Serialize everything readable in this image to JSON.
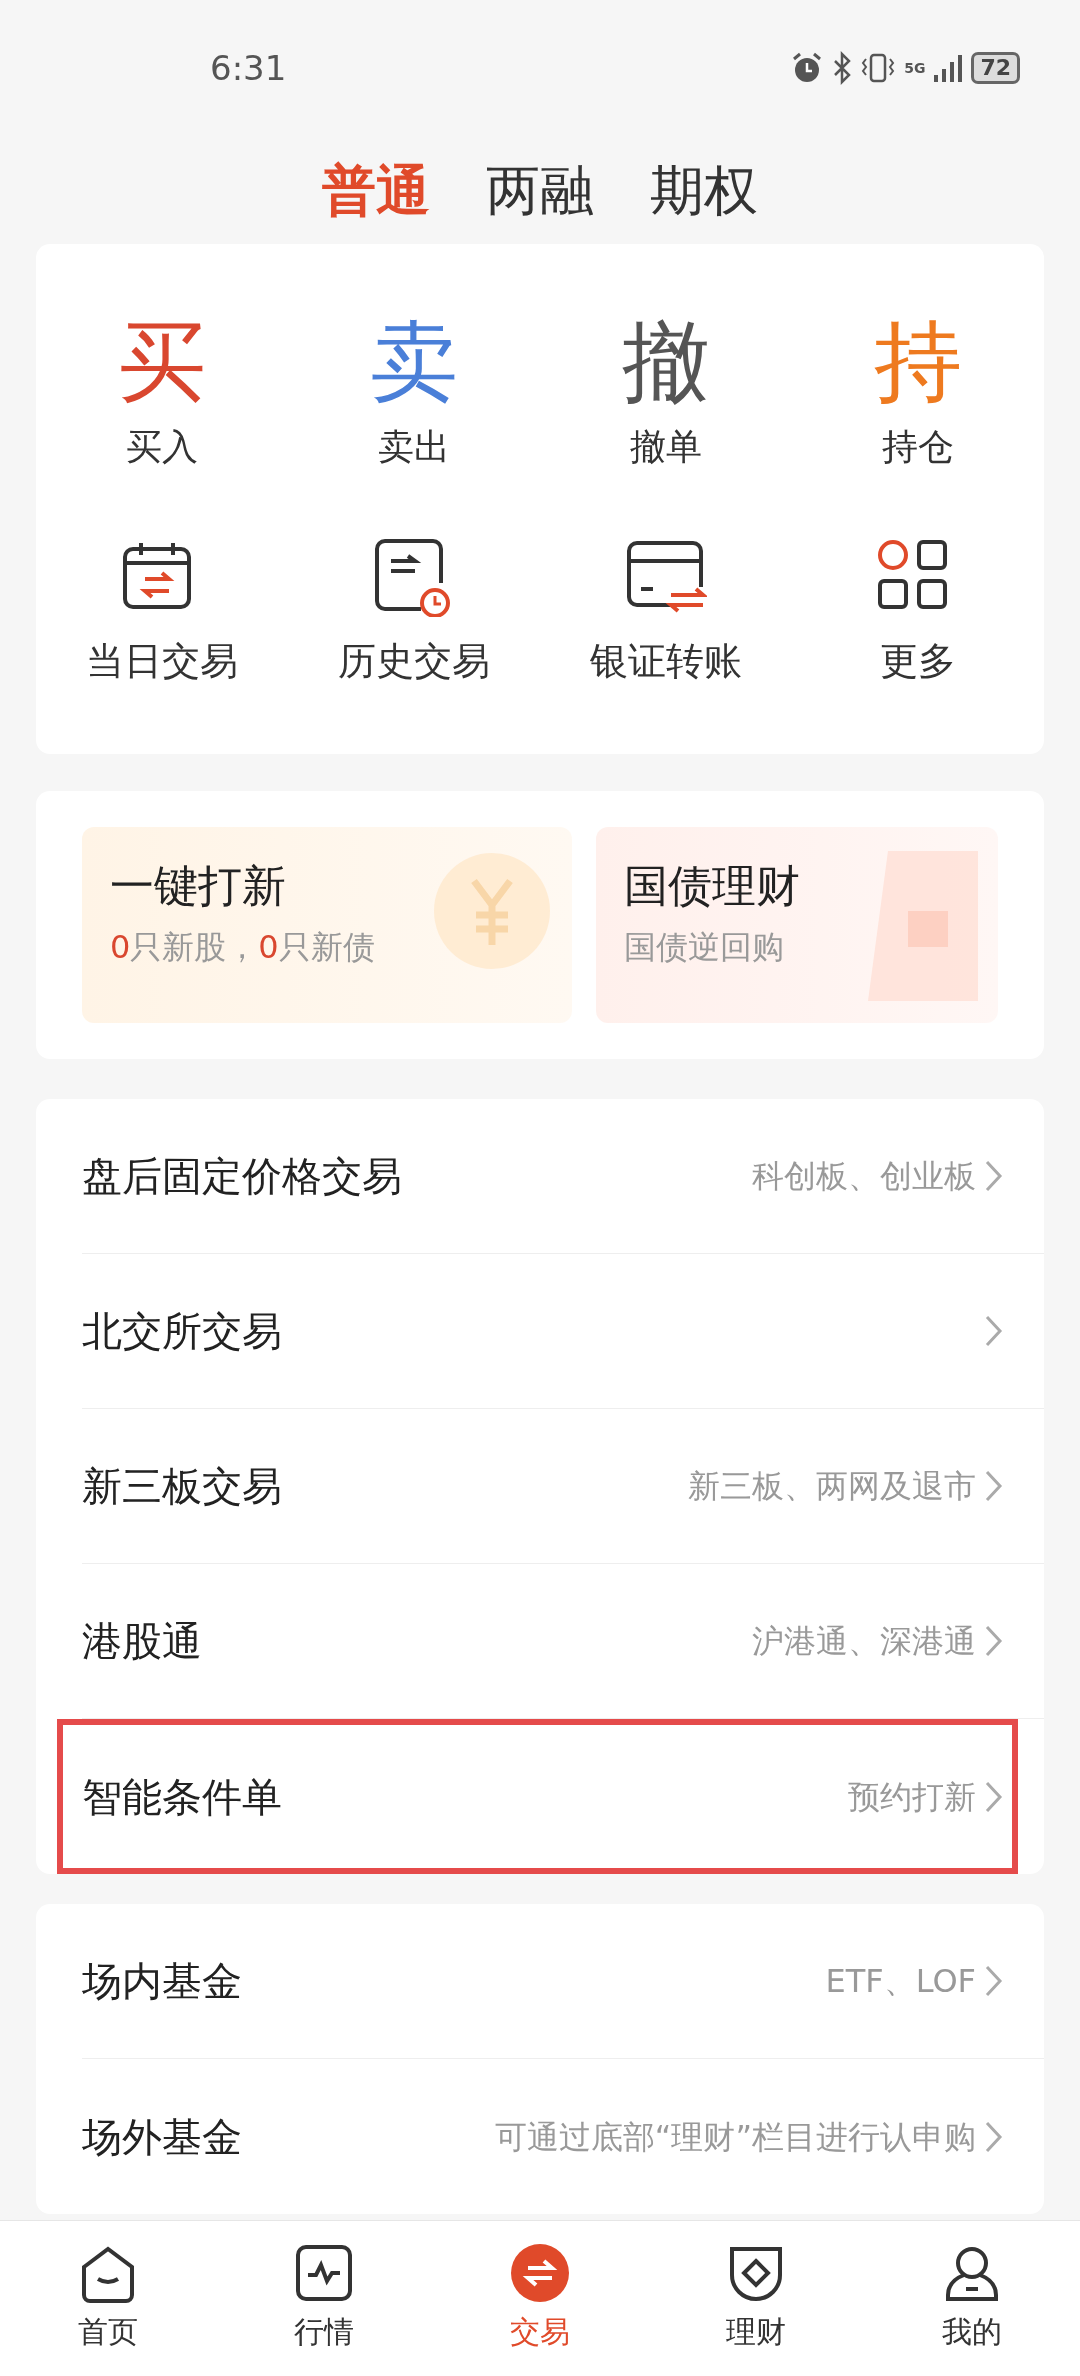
{
  "status_bar": {
    "time": "6:31",
    "network": "5G",
    "battery": "72"
  },
  "tabs": [
    {
      "label": "普通",
      "selected": true
    },
    {
      "label": "两融",
      "selected": false
    },
    {
      "label": "期权",
      "selected": false
    }
  ],
  "quick_actions": [
    {
      "glyph": "买",
      "label": "买入",
      "color": "#d9472f"
    },
    {
      "glyph": "卖",
      "label": "卖出",
      "color": "#4a7fd8"
    },
    {
      "glyph": "撤",
      "label": "撤单",
      "color": "#555555"
    },
    {
      "glyph": "持",
      "label": "持仓",
      "color": "#ee7a1f"
    }
  ],
  "tools": [
    {
      "label": "当日交易"
    },
    {
      "label": "历史交易"
    },
    {
      "label": "银证转账"
    },
    {
      "label": "更多"
    }
  ],
  "promos": [
    {
      "title": "一键打新",
      "subtitle": [
        {
          "text": "0",
          "highlight": true
        },
        {
          "text": "只新股，",
          "highlight": false
        },
        {
          "text": "0",
          "highlight": true
        },
        {
          "text": "只新债",
          "highlight": false
        }
      ]
    },
    {
      "title": "国债理财",
      "subtitle": [
        {
          "text": "国债逆回购",
          "highlight": false
        }
      ]
    }
  ],
  "list_groups": [
    [
      {
        "title": "盘后固定价格交易",
        "detail": "科创板、创业板",
        "highlighted": false
      },
      {
        "title": "北交所交易",
        "highlighted": false
      },
      {
        "title": "新三板交易",
        "detail": "新三板、两网及退市",
        "highlighted": false
      },
      {
        "title": "港股通",
        "detail": "沪港通、深港通",
        "highlighted": false
      },
      {
        "title": "智能条件单",
        "detail": "预约打新",
        "highlighted": true
      }
    ],
    [
      {
        "title": "场内基金",
        "detail": "ETF、LOF",
        "highlighted": false
      },
      {
        "title": "场外基金",
        "detail": "可通过底部“理财”栏目进行认申购",
        "highlighted": false
      }
    ]
  ],
  "bottom_nav": [
    {
      "label": "首页",
      "selected": false
    },
    {
      "label": "行情",
      "selected": false
    },
    {
      "label": "交易",
      "selected": true
    },
    {
      "label": "理财",
      "selected": false
    },
    {
      "label": "我的",
      "selected": false
    }
  ]
}
